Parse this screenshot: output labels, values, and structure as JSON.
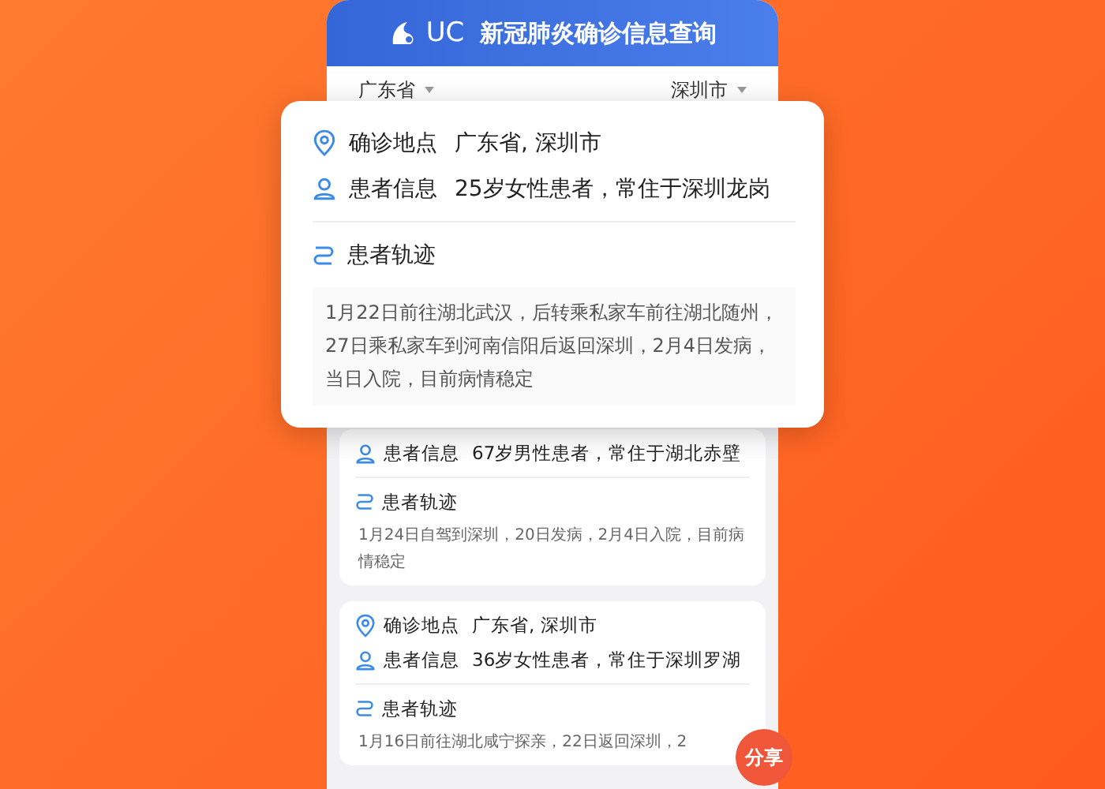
{
  "header": {
    "logo": "UC",
    "title": "新冠肺炎确诊信息查询"
  },
  "filters": [
    {
      "label": "广东省"
    },
    {
      "label": "深圳市"
    }
  ],
  "popup": {
    "location_label": "确诊地点",
    "location_value": "广东省, 深圳市",
    "patient_label": "患者信息",
    "patient_value": "25岁女性患者，常住于深圳龙岗",
    "trajectory_label": "患者轨迹",
    "trajectory_text": "1月22日前往湖北武汉，后转乘私家车前往湖北随州，27日乘私家车到河南信阳后返回深圳，2月4日发病，当日入院，目前病情稳定"
  },
  "cards": [
    {
      "patient_label": "患者信息",
      "patient_value": "67岁男性患者，常住于湖北赤壁",
      "trajectory_label": "患者轨迹",
      "trajectory_text": "1月24日自驾到深圳，20日发病，2月4日入院，目前病情稳定"
    },
    {
      "location_label": "确诊地点",
      "location_value": "广东省, 深圳市",
      "patient_label": "患者信息",
      "patient_value": "36岁女性患者，常住于深圳罗湖",
      "trajectory_label": "患者轨迹",
      "trajectory_text": "1月16日前往湖北咸宁探亲，22日返回深圳，2"
    }
  ],
  "share_button": "分享"
}
